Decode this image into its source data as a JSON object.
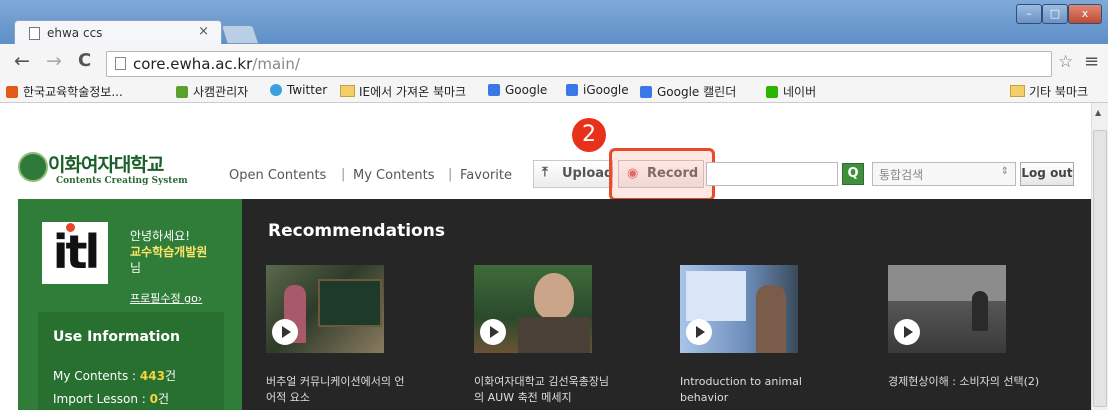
{
  "browser": {
    "tab_title": "ehwa ccs",
    "tab_close": "×",
    "url_host": "core.ewha.ac.kr",
    "url_path": "/main/",
    "window_controls": {
      "minimize": "–",
      "maximize": "□",
      "close": "x"
    }
  },
  "bookmarks": [
    {
      "label": "한국교육학술정보...",
      "icon_color": "#e05a1a"
    },
    {
      "label": "사캠관리자",
      "icon_color": "#5aa02c"
    },
    {
      "label": "Twitter",
      "icon_color": "#3aa0e0"
    },
    {
      "label": "IE에서 가져온 북마크",
      "icon_color": "folder"
    },
    {
      "label": "Google",
      "icon_color": "#3b78e7"
    },
    {
      "label": "iGoogle",
      "icon_color": "#3b78e7"
    },
    {
      "label": "Google 캘린더",
      "icon_color": "#3b78e7"
    },
    {
      "label": "네이버",
      "icon_color": "#2db400"
    }
  ],
  "bookmarks_other": "기타 북마크",
  "site": {
    "logo_title": "이화여자대학교",
    "logo_subtitle": "Contents Creating System",
    "nav": [
      "Open Contents",
      "My Contents",
      "Favorite"
    ],
    "nav_separator": "|",
    "upload_label": "Upload",
    "record_label": "Record",
    "step_badge": "2",
    "scope_select": "통합검색",
    "logout_label": "Log out"
  },
  "sidebar": {
    "logo_text": "itl",
    "greeting_line1": "안녕하세요!",
    "greeting_name": "교수학습개발원",
    "greeting_suffix": "님",
    "profile_link": "프로필수정 go›",
    "use_info_title": "Use Information",
    "stats": [
      {
        "label": "My Contents : ",
        "value": "443",
        "unit": "건"
      },
      {
        "label": "Import Lesson : ",
        "value": "0",
        "unit": "건"
      }
    ]
  },
  "recommendations": {
    "title": "Recommendations",
    "items": [
      {
        "caption": "버추얼 커뮤니케이션에서의 언어적 요소"
      },
      {
        "caption": "이화여자대학교 김선욱총장님의 AUW 축전 메세지"
      },
      {
        "caption": "Introduction to animal behavior"
      },
      {
        "caption": "경제현상이해 : 소비자의 선택(2)"
      }
    ]
  }
}
